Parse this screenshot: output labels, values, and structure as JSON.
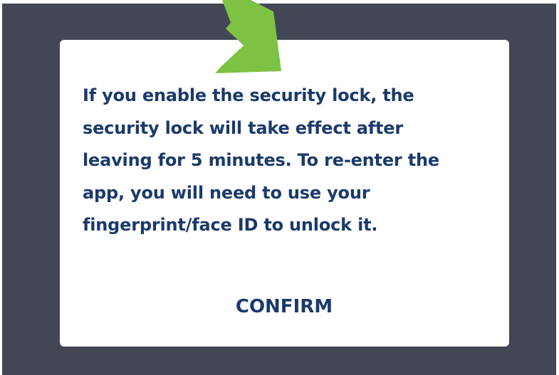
{
  "dialog": {
    "message_lines": [
      "If you enable the security lock, the",
      "security lock will take effect after",
      "leaving for 5 minutes. To re-enter the",
      "app, you will need to use your",
      "fingerprint/face ID to unlock it."
    ],
    "confirm_label": "CONFIRM"
  },
  "colors": {
    "overlay": "#434654",
    "dialog_background": "#ffffff",
    "text": "#1b3a6b",
    "arrow_annotation": "#7dc242"
  },
  "annotation": {
    "icon": "arrow-down-left-icon"
  }
}
